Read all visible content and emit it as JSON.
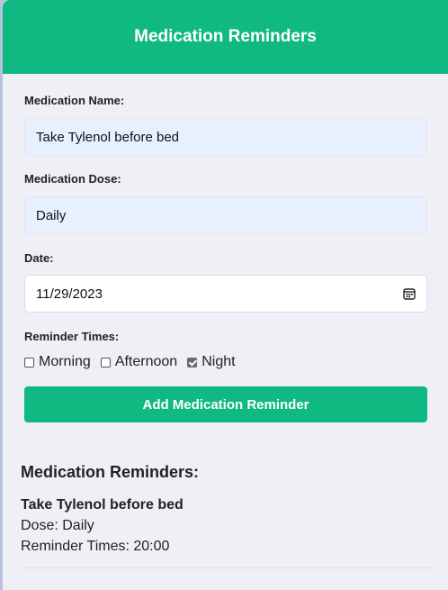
{
  "header": {
    "title": "Medication Reminders"
  },
  "form": {
    "name_label": "Medication Name:",
    "name_value": "Take Tylenol before bed",
    "dose_label": "Medication Dose:",
    "dose_value": "Daily",
    "date_label": "Date:",
    "date_value": "11/29/2023",
    "times_label": "Reminder Times:",
    "times": [
      {
        "label": "Morning",
        "checked": false
      },
      {
        "label": "Afternoon",
        "checked": false
      },
      {
        "label": "Night",
        "checked": true
      }
    ],
    "submit_label": "Add Medication Reminder"
  },
  "reminders": {
    "title": "Medication Reminders:",
    "items": [
      {
        "name": "Take Tylenol before bed",
        "dose": "Dose: Daily",
        "times": "Reminder Times: 20:00"
      }
    ]
  },
  "colors": {
    "accent": "#10b981",
    "background": "#eef0f6"
  }
}
